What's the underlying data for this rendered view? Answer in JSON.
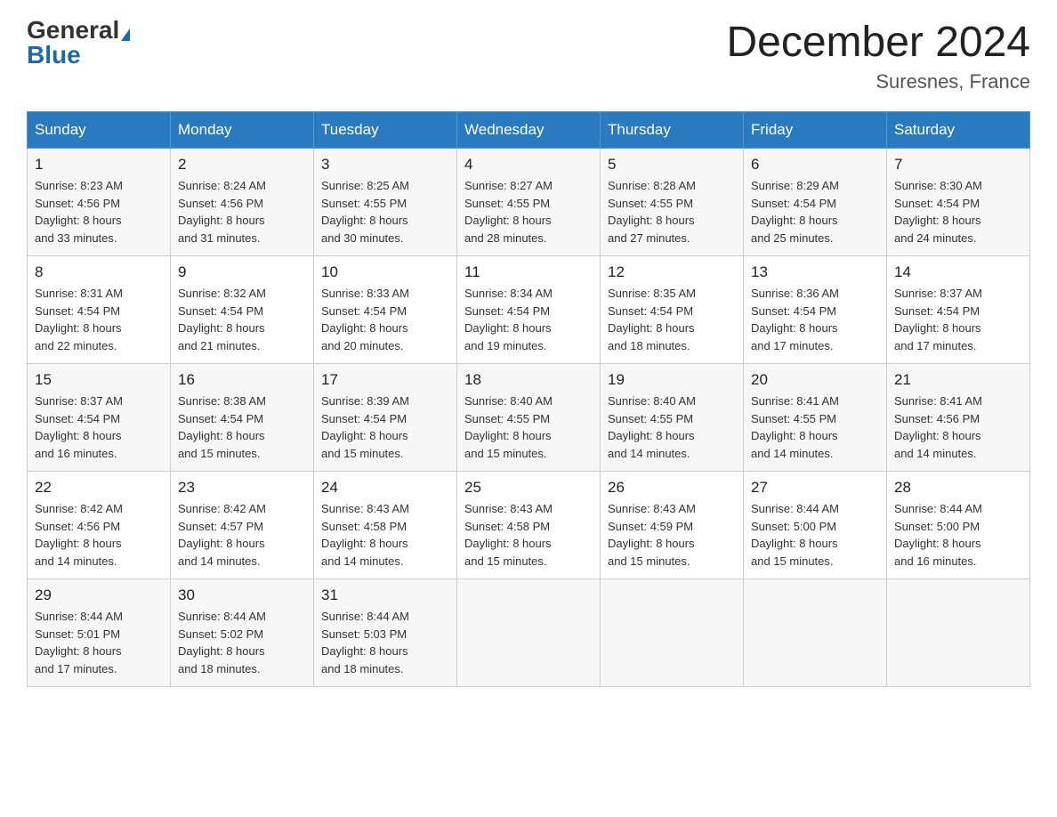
{
  "header": {
    "logo_general": "General",
    "logo_blue": "Blue",
    "month_title": "December 2024",
    "location": "Suresnes, France"
  },
  "days_of_week": [
    "Sunday",
    "Monday",
    "Tuesday",
    "Wednesday",
    "Thursday",
    "Friday",
    "Saturday"
  ],
  "weeks": [
    [
      {
        "day": "1",
        "sunrise": "8:23 AM",
        "sunset": "4:56 PM",
        "daylight": "8 hours and 33 minutes."
      },
      {
        "day": "2",
        "sunrise": "8:24 AM",
        "sunset": "4:56 PM",
        "daylight": "8 hours and 31 minutes."
      },
      {
        "day": "3",
        "sunrise": "8:25 AM",
        "sunset": "4:55 PM",
        "daylight": "8 hours and 30 minutes."
      },
      {
        "day": "4",
        "sunrise": "8:27 AM",
        "sunset": "4:55 PM",
        "daylight": "8 hours and 28 minutes."
      },
      {
        "day": "5",
        "sunrise": "8:28 AM",
        "sunset": "4:55 PM",
        "daylight": "8 hours and 27 minutes."
      },
      {
        "day": "6",
        "sunrise": "8:29 AM",
        "sunset": "4:54 PM",
        "daylight": "8 hours and 25 minutes."
      },
      {
        "day": "7",
        "sunrise": "8:30 AM",
        "sunset": "4:54 PM",
        "daylight": "8 hours and 24 minutes."
      }
    ],
    [
      {
        "day": "8",
        "sunrise": "8:31 AM",
        "sunset": "4:54 PM",
        "daylight": "8 hours and 22 minutes."
      },
      {
        "day": "9",
        "sunrise": "8:32 AM",
        "sunset": "4:54 PM",
        "daylight": "8 hours and 21 minutes."
      },
      {
        "day": "10",
        "sunrise": "8:33 AM",
        "sunset": "4:54 PM",
        "daylight": "8 hours and 20 minutes."
      },
      {
        "day": "11",
        "sunrise": "8:34 AM",
        "sunset": "4:54 PM",
        "daylight": "8 hours and 19 minutes."
      },
      {
        "day": "12",
        "sunrise": "8:35 AM",
        "sunset": "4:54 PM",
        "daylight": "8 hours and 18 minutes."
      },
      {
        "day": "13",
        "sunrise": "8:36 AM",
        "sunset": "4:54 PM",
        "daylight": "8 hours and 17 minutes."
      },
      {
        "day": "14",
        "sunrise": "8:37 AM",
        "sunset": "4:54 PM",
        "daylight": "8 hours and 17 minutes."
      }
    ],
    [
      {
        "day": "15",
        "sunrise": "8:37 AM",
        "sunset": "4:54 PM",
        "daylight": "8 hours and 16 minutes."
      },
      {
        "day": "16",
        "sunrise": "8:38 AM",
        "sunset": "4:54 PM",
        "daylight": "8 hours and 15 minutes."
      },
      {
        "day": "17",
        "sunrise": "8:39 AM",
        "sunset": "4:54 PM",
        "daylight": "8 hours and 15 minutes."
      },
      {
        "day": "18",
        "sunrise": "8:40 AM",
        "sunset": "4:55 PM",
        "daylight": "8 hours and 15 minutes."
      },
      {
        "day": "19",
        "sunrise": "8:40 AM",
        "sunset": "4:55 PM",
        "daylight": "8 hours and 14 minutes."
      },
      {
        "day": "20",
        "sunrise": "8:41 AM",
        "sunset": "4:55 PM",
        "daylight": "8 hours and 14 minutes."
      },
      {
        "day": "21",
        "sunrise": "8:41 AM",
        "sunset": "4:56 PM",
        "daylight": "8 hours and 14 minutes."
      }
    ],
    [
      {
        "day": "22",
        "sunrise": "8:42 AM",
        "sunset": "4:56 PM",
        "daylight": "8 hours and 14 minutes."
      },
      {
        "day": "23",
        "sunrise": "8:42 AM",
        "sunset": "4:57 PM",
        "daylight": "8 hours and 14 minutes."
      },
      {
        "day": "24",
        "sunrise": "8:43 AM",
        "sunset": "4:58 PM",
        "daylight": "8 hours and 14 minutes."
      },
      {
        "day": "25",
        "sunrise": "8:43 AM",
        "sunset": "4:58 PM",
        "daylight": "8 hours and 15 minutes."
      },
      {
        "day": "26",
        "sunrise": "8:43 AM",
        "sunset": "4:59 PM",
        "daylight": "8 hours and 15 minutes."
      },
      {
        "day": "27",
        "sunrise": "8:44 AM",
        "sunset": "5:00 PM",
        "daylight": "8 hours and 15 minutes."
      },
      {
        "day": "28",
        "sunrise": "8:44 AM",
        "sunset": "5:00 PM",
        "daylight": "8 hours and 16 minutes."
      }
    ],
    [
      {
        "day": "29",
        "sunrise": "8:44 AM",
        "sunset": "5:01 PM",
        "daylight": "8 hours and 17 minutes."
      },
      {
        "day": "30",
        "sunrise": "8:44 AM",
        "sunset": "5:02 PM",
        "daylight": "8 hours and 18 minutes."
      },
      {
        "day": "31",
        "sunrise": "8:44 AM",
        "sunset": "5:03 PM",
        "daylight": "8 hours and 18 minutes."
      },
      null,
      null,
      null,
      null
    ]
  ],
  "labels": {
    "sunrise": "Sunrise:",
    "sunset": "Sunset:",
    "daylight": "Daylight:"
  }
}
